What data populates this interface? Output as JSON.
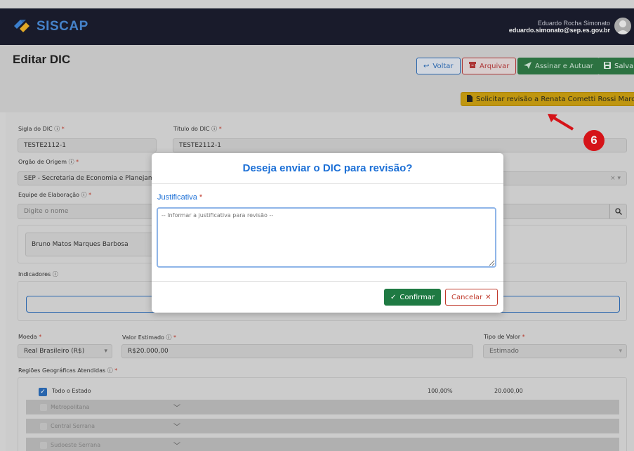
{
  "app": {
    "name": "SISCAP"
  },
  "user": {
    "name": "Eduardo Rocha Simonato",
    "email": "eduardo.simonato@sep.es.gov.br"
  },
  "page": {
    "title": "Editar DIC"
  },
  "toolbar": {
    "voltar": "Voltar",
    "arquivar": "Arquivar",
    "assinar": "Assinar e Autuar",
    "salvar": "Salvar",
    "revisao": "Solicitar revisão a Renata Cometti Rossi Marcari"
  },
  "annotation": {
    "step": "6",
    "color": "#e3151a"
  },
  "form": {
    "sigla_label": "Sigla do DIC",
    "sigla_value": "TESTE2112-1",
    "titulo_label": "Título do DIC",
    "titulo_value": "TESTE2112-1",
    "orgao_label": "Orgão de Origem",
    "orgao_value": "SEP - Secretaria de Economia e Planejamento",
    "equipe_label": "Equipe de Elaboração",
    "equipe_placeholder": "Digite o nome",
    "equipe_member": "Bruno Matos Marques Barbosa",
    "indicadores_label": "Indicadores",
    "moeda_label": "Moeda",
    "moeda_value": "Real Brasileiro (R$)",
    "valor_label": "Valor Estimado",
    "valor_value": "R$20.000,00",
    "tipo_label": "Tipo de Valor",
    "tipo_value": "Estimado",
    "regioes_label": "Regiões Geográficas Atendidas",
    "regions": [
      {
        "name": "Todo o Estado",
        "percent": "100,00%",
        "value": "20.000,00",
        "checked": true
      },
      {
        "name": "Metropolitana",
        "checked": false
      },
      {
        "name": "Central Serrana",
        "checked": false
      },
      {
        "name": "Sudoeste Serrana",
        "checked": false
      }
    ]
  },
  "modal": {
    "title": "Deseja enviar o DIC para revisão?",
    "justificativa_label": "Justificativa",
    "justificativa_placeholder": "-- Informar a justificativa para revisão --",
    "confirm": "Confirmar",
    "cancel": "Cancelar"
  },
  "colors": {
    "primary": "#1b6fd6",
    "success": "#1f7a43",
    "danger": "#c0392b",
    "warning": "#cba012",
    "navbar": "#1b1d2e"
  }
}
